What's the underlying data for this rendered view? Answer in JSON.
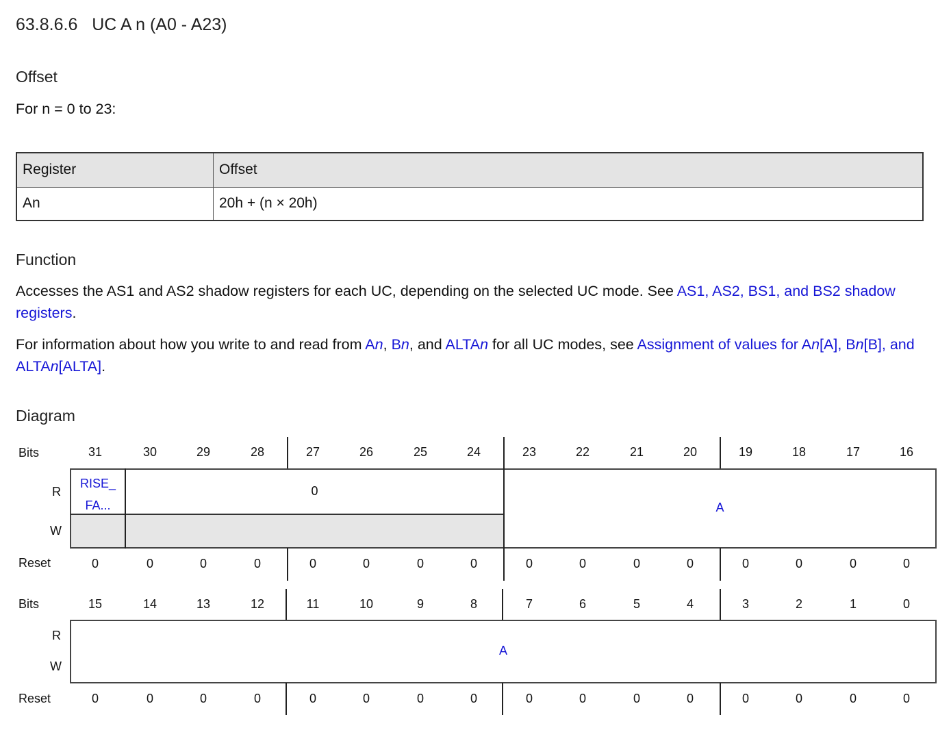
{
  "heading": "63.8.6.6   UC A n (A0 - A23)",
  "offset_section": {
    "heading": "Offset",
    "intro": "For n = 0 to 23:",
    "table": {
      "headers": [
        "Register",
        "Offset"
      ],
      "rows": [
        [
          "An",
          "20h + (n × 20h)"
        ]
      ]
    }
  },
  "function_section": {
    "heading": "Function",
    "p1_text": "Accesses the AS1 and AS2 shadow registers for each UC, depending on the selected UC mode. See ",
    "p1_link": "AS1, AS2, BS1, and BS2 shadow registers",
    "p1_end": ".",
    "p2_a": "For information about how you write to and read from ",
    "p2_An": "A",
    "p2_n1": "n",
    "p2_comma1": ", ",
    "p2_Bn": "B",
    "p2_n2": "n",
    "p2_and": ", and ",
    "p2_ALTA": "ALTA",
    "p2_n3": "n",
    "p2_b": " for all UC modes, see ",
    "p2_link1": "Assignment of values for A",
    "p2_link_n1": "n",
    "p2_link2": "[A], B",
    "p2_link_n2": "n",
    "p2_link3": "[B], and ALTA",
    "p2_link_n3": "n",
    "p2_link4": "[ALTA]",
    "p2_end": "."
  },
  "diagram": {
    "heading": "Diagram",
    "labels": {
      "bits": "Bits",
      "r": "R",
      "w": "W",
      "reset": "Reset"
    },
    "upper": {
      "bits": [
        "31",
        "30",
        "29",
        "28",
        "27",
        "26",
        "25",
        "24",
        "23",
        "22",
        "21",
        "20",
        "19",
        "18",
        "17",
        "16"
      ],
      "reset": [
        "0",
        "0",
        "0",
        "0",
        "0",
        "0",
        "0",
        "0",
        "0",
        "0",
        "0",
        "0",
        "0",
        "0",
        "0",
        "0"
      ],
      "fields": {
        "rise_fa_line1": "RISE_",
        "rise_fa_line2": "FA...",
        "reserved_read": "0",
        "a": "A"
      }
    },
    "lower": {
      "bits": [
        "15",
        "14",
        "13",
        "12",
        "11",
        "10",
        "9",
        "8",
        "7",
        "6",
        "5",
        "4",
        "3",
        "2",
        "1",
        "0"
      ],
      "reset": [
        "0",
        "0",
        "0",
        "0",
        "0",
        "0",
        "0",
        "0",
        "0",
        "0",
        "0",
        "0",
        "0",
        "0",
        "0",
        "0"
      ],
      "fields": {
        "a": "A"
      }
    },
    "colors": {
      "link": "#1515d6",
      "reserved_fill": "#e6e6e6"
    }
  }
}
